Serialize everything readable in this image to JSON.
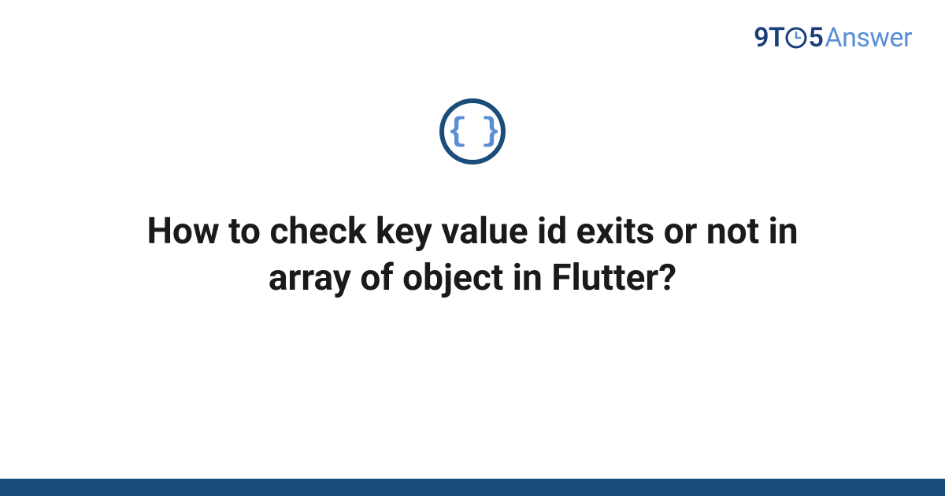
{
  "brand": {
    "part1": "9T",
    "part2": "5",
    "part3": "Answer"
  },
  "topic_icon": {
    "glyph": "{ }",
    "name": "code-braces"
  },
  "title": "How to check key value id exits or not in array of object in Flutter?",
  "colors": {
    "dark_blue": "#1a4d7a",
    "light_blue": "#5a8fd6",
    "brand_dark": "#1a3f7a"
  }
}
